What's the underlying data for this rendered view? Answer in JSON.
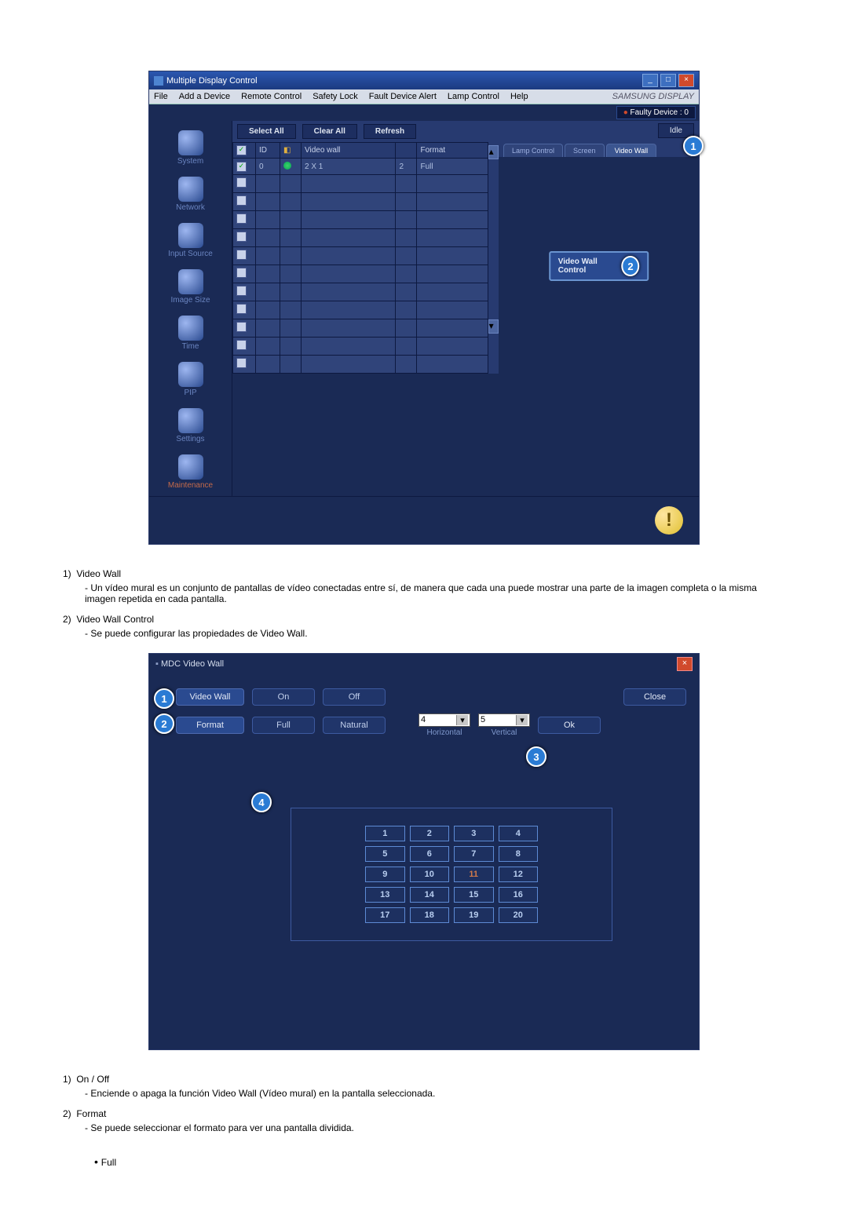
{
  "window1": {
    "title": "Multiple Display Control",
    "brand": "SAMSUNG DISPLAY",
    "menu": [
      "File",
      "Add a Device",
      "Remote Control",
      "Safety Lock",
      "Fault Device Alert",
      "Lamp Control",
      "Help"
    ],
    "faulty": "Faulty Device : 0",
    "idle": "Idle",
    "toolbar": {
      "selectAll": "Select All",
      "clearAll": "Clear All",
      "refresh": "Refresh"
    },
    "tabs": {
      "lamp": "Lamp Control",
      "screen": "Screen",
      "video": "Video Wall"
    },
    "tableHeaders": {
      "chk": "",
      "id": "ID",
      "pwr": "",
      "vw": "Video wall",
      "n": "",
      "fmt": "Format"
    },
    "row0": {
      "id": "0",
      "vw": "2 X 1",
      "n": "2",
      "fmt": "Full"
    },
    "vwControl": "Video Wall Control"
  },
  "sidebar": {
    "items": [
      "System",
      "Network",
      "Input Source",
      "Image Size",
      "Time",
      "PIP",
      "Settings",
      "Maintenance"
    ]
  },
  "text1": {
    "i1_title": "Video Wall",
    "i1_body": "Un vídeo mural es un conjunto de pantallas de vídeo conectadas entre sí, de manera que cada una puede mostrar una parte de la imagen completa o la misma imagen repetida en cada pantalla.",
    "i2_title": "Video Wall Control",
    "i2_body": "Se puede configurar las propiedades de Video Wall."
  },
  "window2": {
    "title": "MDC Video Wall",
    "videoWall": "Video Wall",
    "on": "On",
    "off": "Off",
    "close": "Close",
    "format": "Format",
    "full": "Full",
    "natural": "Natural",
    "h_val": "4",
    "h_lab": "Horizontal",
    "v_val": "5",
    "v_lab": "Vertical",
    "ok": "Ok",
    "cells": [
      "1",
      "2",
      "3",
      "4",
      "5",
      "6",
      "7",
      "8",
      "9",
      "10",
      "11",
      "12",
      "13",
      "14",
      "15",
      "16",
      "17",
      "18",
      "19",
      "20"
    ]
  },
  "text2": {
    "i1_title": "On / Off",
    "i1_body": "Enciende o apaga la función Video Wall (Vídeo mural) en la pantalla seleccionada.",
    "i2_title": "Format",
    "i2_body": "Se puede seleccionar el formato para ver una pantalla dividida.",
    "bullet": "Full"
  }
}
